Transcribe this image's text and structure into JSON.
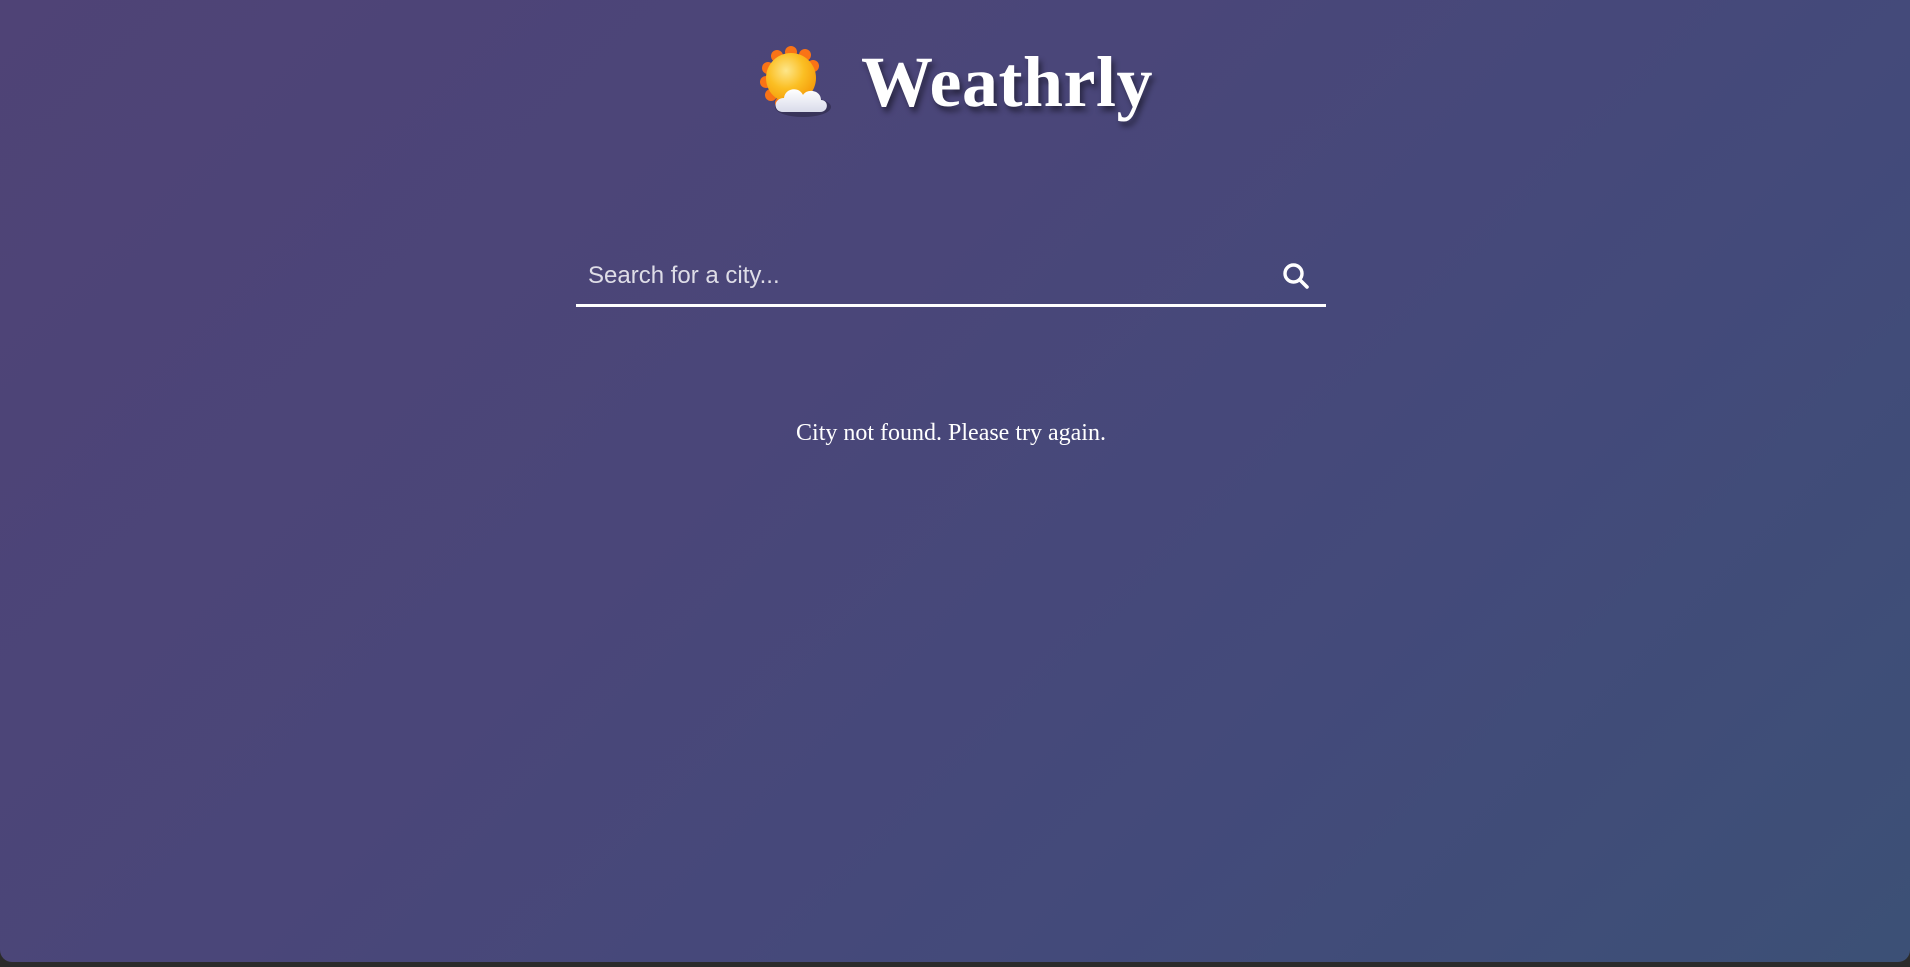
{
  "header": {
    "logo_icon": "sun-behind-cloud-icon",
    "title": "Weathrly"
  },
  "search": {
    "placeholder": "Search for a city...",
    "value": "",
    "button_icon": "search-icon"
  },
  "status": {
    "message": "City not found. Please try again."
  },
  "colors": {
    "background_start": "#4f4376",
    "background_end": "#3c5076",
    "text": "#ffffff",
    "sun": "#fbbf24",
    "sun_rays": "#f97316",
    "cloud": "#eef0f7"
  }
}
